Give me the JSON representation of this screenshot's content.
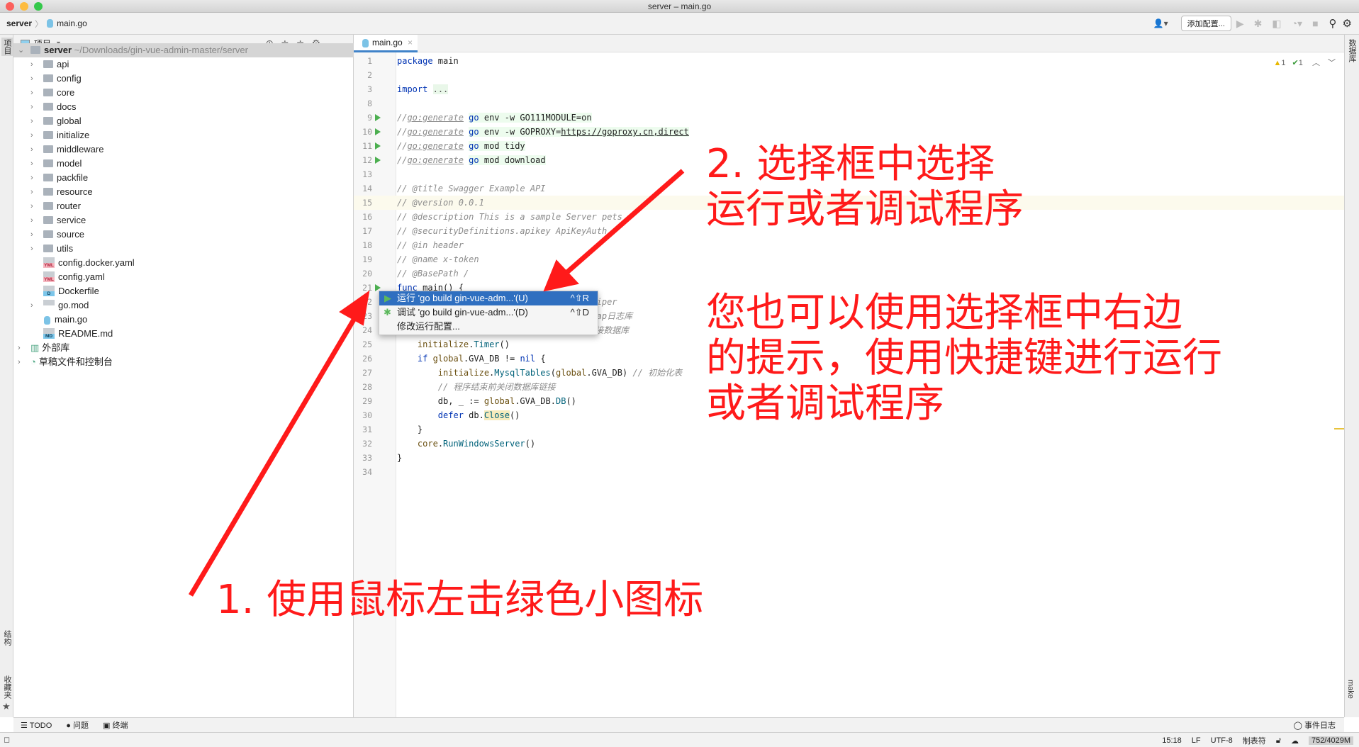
{
  "window": {
    "title": "server – main.go"
  },
  "nav": {
    "project": "server",
    "file": "main.go"
  },
  "toolbar": {
    "add_config": "添加配置..."
  },
  "panel": {
    "title": "项目",
    "root_name": "server",
    "root_path": "~/Downloads/gin-vue-admin-master/server",
    "folders": [
      "api",
      "config",
      "core",
      "docs",
      "global",
      "initialize",
      "middleware",
      "model",
      "packfile",
      "resource",
      "router",
      "service",
      "source",
      "utils"
    ],
    "files": [
      {
        "name": "config.docker.yaml",
        "badge": "YML"
      },
      {
        "name": "config.yaml",
        "badge": "YML"
      },
      {
        "name": "Dockerfile",
        "badge": "D"
      },
      {
        "name": "go.mod",
        "badge": ""
      },
      {
        "name": "main.go",
        "badge": ""
      },
      {
        "name": "README.md",
        "badge": "MD"
      }
    ],
    "extra": [
      "外部库",
      "草稿文件和控制台"
    ]
  },
  "left_strip": {
    "project": "项目",
    "structure": "结构",
    "favorites": "收藏夹"
  },
  "right_strip": {
    "database": "数据库",
    "make": "make"
  },
  "editor": {
    "tab": "main.go",
    "warnings": "1",
    "checks": "1",
    "lines": [
      {
        "n": "1",
        "toks": [
          [
            "package",
            "kw"
          ],
          [
            " main",
            ""
          ]
        ]
      },
      {
        "n": "2",
        "toks": []
      },
      {
        "n": "3",
        "toks": [
          [
            "import",
            "kw"
          ],
          [
            " ",
            ""
          ],
          [
            "...",
            "fold"
          ]
        ]
      },
      {
        "n": "8",
        "toks": []
      },
      {
        "n": "9",
        "run": true,
        "toks": [
          [
            "//",
            "cm"
          ],
          [
            "go:generate",
            "gen"
          ],
          [
            " ",
            ""
          ],
          [
            "go",
            "kw hl"
          ],
          [
            " env -w GO111MODULE=on",
            "hl"
          ]
        ]
      },
      {
        "n": "10",
        "run": true,
        "toks": [
          [
            "//",
            "cm"
          ],
          [
            "go:generate",
            "gen"
          ],
          [
            " ",
            ""
          ],
          [
            "go",
            "kw hl"
          ],
          [
            " env -w GOPROXY=",
            "hl"
          ],
          [
            "https://goproxy.cn,direct",
            "hl ul"
          ]
        ]
      },
      {
        "n": "11",
        "run": true,
        "toks": [
          [
            "//",
            "cm"
          ],
          [
            "go:generate",
            "gen"
          ],
          [
            " ",
            ""
          ],
          [
            "go",
            "kw hl"
          ],
          [
            " mod tidy",
            "hl"
          ]
        ]
      },
      {
        "n": "12",
        "run": true,
        "toks": [
          [
            "//",
            "cm"
          ],
          [
            "go:generate",
            "gen"
          ],
          [
            " ",
            ""
          ],
          [
            "go",
            "kw hl"
          ],
          [
            " mod download",
            "hl"
          ]
        ]
      },
      {
        "n": "13",
        "toks": []
      },
      {
        "n": "14",
        "toks": [
          [
            "// @title Swagger Example API",
            "cm"
          ]
        ]
      },
      {
        "n": "15",
        "cur": true,
        "toks": [
          [
            "// @version 0.0.1",
            "cm"
          ]
        ]
      },
      {
        "n": "16",
        "toks": [
          [
            "// @description This is a sample Server pets",
            "cm"
          ]
        ]
      },
      {
        "n": "17",
        "toks": [
          [
            "// @securityDefinitions.apikey ApiKeyAuth",
            "cm"
          ]
        ]
      },
      {
        "n": "18",
        "toks": [
          [
            "// @in header",
            "cm"
          ]
        ]
      },
      {
        "n": "19",
        "toks": [
          [
            "// @name x-token",
            "cm"
          ]
        ]
      },
      {
        "n": "20",
        "toks": [
          [
            "// @BasePath /",
            "cm"
          ]
        ]
      },
      {
        "n": "21",
        "run": true,
        "toks": [
          [
            "func",
            "kw"
          ],
          [
            " main() {",
            ""
          ]
        ]
      },
      {
        "n": "22",
        "toks": [
          [
            "                                 初始化Viper",
            "cm"
          ]
        ]
      },
      {
        "n": "23",
        "toks": [
          [
            "                                 初始化zap日志库",
            "cm"
          ]
        ]
      },
      {
        "n": "24",
        "toks": [
          [
            "                                 gorm连接数据库",
            "cm"
          ]
        ]
      },
      {
        "n": "25",
        "toks": [
          [
            "    ",
            ""
          ],
          [
            "initialize",
            "pk"
          ],
          [
            ".",
            ""
          ],
          [
            "Timer",
            "fn"
          ],
          [
            "()",
            ""
          ]
        ]
      },
      {
        "n": "26",
        "toks": [
          [
            "    ",
            ""
          ],
          [
            "if",
            "kw"
          ],
          [
            " ",
            ""
          ],
          [
            "global",
            "pk"
          ],
          [
            ".GVA_DB != ",
            ""
          ],
          [
            "nil",
            "kw"
          ],
          [
            " {",
            ""
          ]
        ]
      },
      {
        "n": "27",
        "toks": [
          [
            "        ",
            ""
          ],
          [
            "initialize",
            "pk"
          ],
          [
            ".",
            ""
          ],
          [
            "MysqlTables",
            "fn"
          ],
          [
            "(",
            ""
          ],
          [
            "global",
            "pk"
          ],
          [
            ".GVA_DB) ",
            ""
          ],
          [
            "// 初始化表",
            "cm"
          ]
        ]
      },
      {
        "n": "28",
        "toks": [
          [
            "        ",
            ""
          ],
          [
            "// 程序结束前关闭数据库链接",
            "cm"
          ]
        ]
      },
      {
        "n": "29",
        "toks": [
          [
            "        db, _ := ",
            ""
          ],
          [
            "global",
            "pk"
          ],
          [
            ".GVA_DB.",
            ""
          ],
          [
            "DB",
            "fn"
          ],
          [
            "()",
            ""
          ]
        ]
      },
      {
        "n": "30",
        "toks": [
          [
            "        ",
            ""
          ],
          [
            "defer",
            "kw"
          ],
          [
            " db.",
            ""
          ],
          [
            "Close",
            "fn cls"
          ],
          [
            "()",
            ""
          ]
        ]
      },
      {
        "n": "31",
        "toks": [
          [
            "    }",
            ""
          ]
        ]
      },
      {
        "n": "32",
        "toks": [
          [
            "    ",
            ""
          ],
          [
            "core",
            "pk"
          ],
          [
            ".",
            ""
          ],
          [
            "RunWindowsServer",
            "fn"
          ],
          [
            "()",
            ""
          ]
        ]
      },
      {
        "n": "33",
        "toks": [
          [
            "}",
            ""
          ]
        ]
      },
      {
        "n": "34",
        "toks": []
      }
    ]
  },
  "popup": {
    "items": [
      {
        "label": "运行 'go build gin-vue-adm...'(U)",
        "shortcut": "^⇧R",
        "icon": "run-icon"
      },
      {
        "label": "调试 'go build gin-vue-adm...'(D)",
        "shortcut": "^⇧D",
        "icon": "debug-icon"
      },
      {
        "label": "修改运行配置...",
        "shortcut": "",
        "icon": ""
      }
    ]
  },
  "annotations": {
    "step2_line1": "2. 选择框中选择",
    "step2_line2": "运行或者调试程序",
    "tip_line1": "您也可以使用选择框中右边",
    "tip_line2": "的提示，使用快捷键进行运行",
    "tip_line3": "或者调试程序",
    "step1": "1. 使用鼠标左击绿色小图标",
    "color": "#ff1a1a"
  },
  "toolwindows": {
    "todo": "TODO",
    "problems": "问题",
    "terminal": "终端",
    "event_log": "事件日志"
  },
  "status": {
    "position": "15:18",
    "line_sep": "LF",
    "encoding": "UTF-8",
    "indent": "制表符",
    "memory": "752/4029M"
  }
}
